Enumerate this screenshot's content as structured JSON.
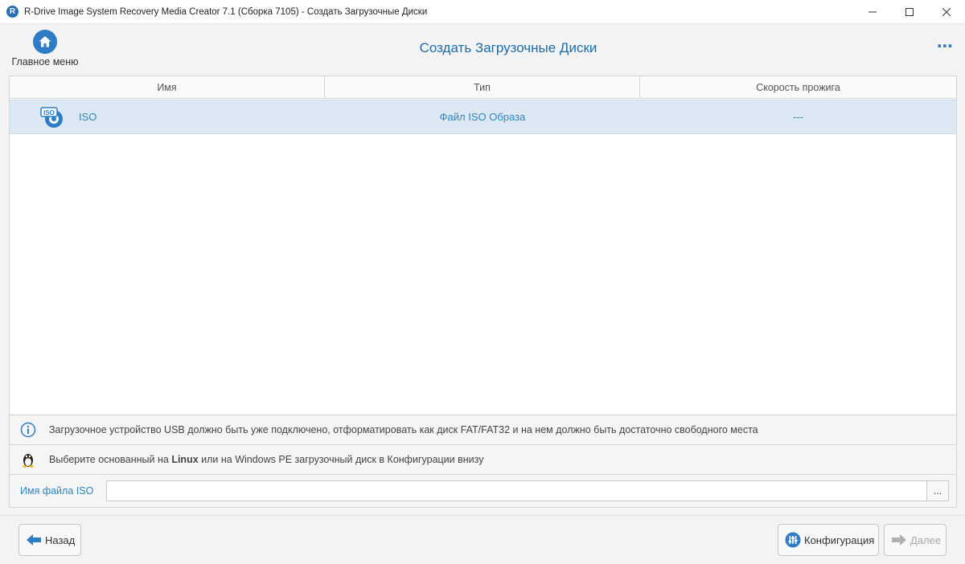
{
  "window": {
    "title": "R-Drive Image System Recovery Media Creator 7.1 (Сборка 7105) - Создать Загрузочные Диски",
    "app_icon_letter": "R",
    "controls": {
      "minimize": "—",
      "maximize": "☐",
      "close": "✕"
    }
  },
  "header": {
    "home_label": "Главное меню",
    "page_title": "Создать Загрузочные Диски",
    "more_icon": "⋯"
  },
  "table": {
    "columns": [
      "Имя",
      "Тип",
      "Скорость прожига"
    ],
    "rows": [
      {
        "name": "ISO",
        "type": "Файл ISO Образа",
        "speed": "---",
        "icon": "iso-disc-icon",
        "selected": true
      }
    ]
  },
  "notices": {
    "usb": "Загрузочное устройство USB должно быть уже подключено, отформатировать как диск FAT/FAT32 и на нем должно быть достаточно свободного места",
    "linux_prefix": "Выберите основанный на ",
    "linux_bold": "Linux",
    "linux_suffix": " или на Windows PE загрузочный диск в Конфигурации внизу"
  },
  "iso_file": {
    "label": "Имя файла ISO",
    "value": "",
    "browse_label": "..."
  },
  "footer": {
    "back_label": "Назад",
    "config_label": "Конфигурация",
    "next_label": "Далее"
  },
  "colors": {
    "accent": "#2e7cc6",
    "selected_row": "#dce8f3",
    "link_text": "#2e86c1"
  }
}
